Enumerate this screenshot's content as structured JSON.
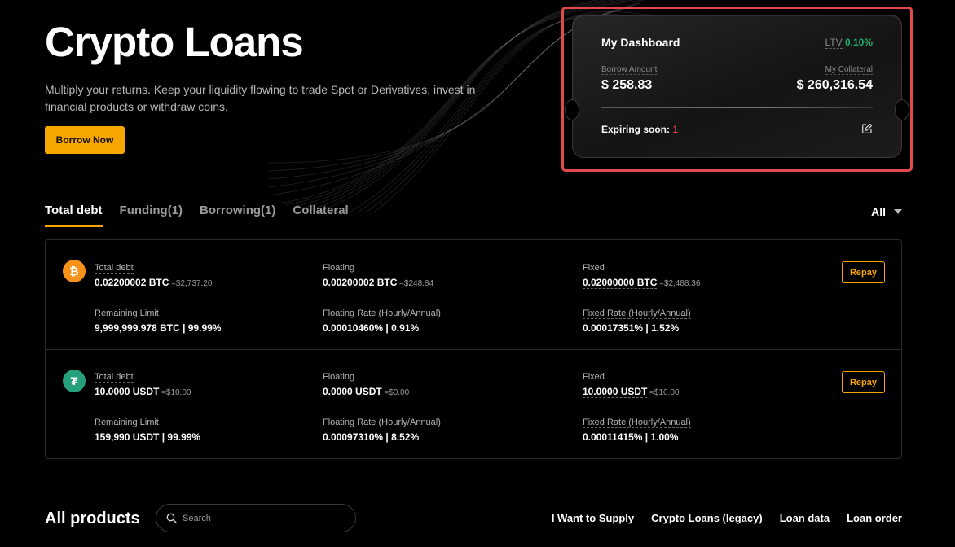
{
  "hero": {
    "title": "Crypto Loans",
    "description": "Multiply your returns. Keep your liquidity flowing to trade Spot or Derivatives, invest in financial products or withdraw coins.",
    "borrow_button": "Borrow Now"
  },
  "dashboard": {
    "title": "My Dashboard",
    "ltv_label": "LTV",
    "ltv_value": "0.10%",
    "borrow_amount_label": "Borrow Amount",
    "borrow_amount_value": "$ 258.83",
    "collateral_label": "My Collateral",
    "collateral_value": "$ 260,316.54",
    "expiring_label": "Expiring soon:",
    "expiring_count": "1",
    "edit_icon": "edit-icon"
  },
  "tabs": [
    {
      "label": "Total debt",
      "active": true
    },
    {
      "label": "Funding(1)",
      "active": false
    },
    {
      "label": "Borrowing(1)",
      "active": false
    },
    {
      "label": "Collateral",
      "active": false
    }
  ],
  "filter": {
    "label": "All"
  },
  "rows": [
    {
      "coin": "BTC",
      "coin_glyph": "₿",
      "total_debt_label": "Total debt",
      "total_debt_value": "0.02200002 BTC",
      "total_debt_approx": "≈$2,737.20",
      "floating_label": "Floating",
      "floating_value": "0.00200002 BTC",
      "floating_approx": "≈$248.84",
      "fixed_label": "Fixed",
      "fixed_value": "0.02000000 BTC",
      "fixed_approx": "≈$2,488.36",
      "remaining_label": "Remaining Limit",
      "remaining_value": "9,999,999.978 BTC | 99.99%",
      "floating_rate_label": "Floating Rate (Hourly/Annual)",
      "floating_rate_value": "0.00010460% | 0.91%",
      "fixed_rate_label": "Fixed Rate (Hourly/Annual)",
      "fixed_rate_value": "0.00017351% | 1.52%",
      "repay_label": "Repay"
    },
    {
      "coin": "USDT",
      "coin_glyph": "₮",
      "total_debt_label": "Total debt",
      "total_debt_value": "10.0000 USDT",
      "total_debt_approx": "≈$10.00",
      "floating_label": "Floating",
      "floating_value": "0.0000 USDT",
      "floating_approx": "≈$0.00",
      "fixed_label": "Fixed",
      "fixed_value": "10.0000 USDT",
      "fixed_approx": "≈$10.00",
      "remaining_label": "Remaining Limit",
      "remaining_value": "159,990 USDT | 99.99%",
      "floating_rate_label": "Floating Rate (Hourly/Annual)",
      "floating_rate_value": "0.00097310% | 8.52%",
      "fixed_rate_label": "Fixed Rate (Hourly/Annual)",
      "fixed_rate_value": "0.00011415% | 1.00%",
      "repay_label": "Repay"
    }
  ],
  "products": {
    "title": "All products",
    "search_placeholder": "Search",
    "links": [
      "I Want to Supply",
      "Crypto Loans (legacy)",
      "Loan data",
      "Loan order"
    ]
  },
  "colors": {
    "accent": "#f7a600",
    "positive": "#20b26c",
    "negative": "#f6465d",
    "highlight_border": "#e04a4a",
    "btc": "#f7931a",
    "usdt": "#26a17b"
  }
}
